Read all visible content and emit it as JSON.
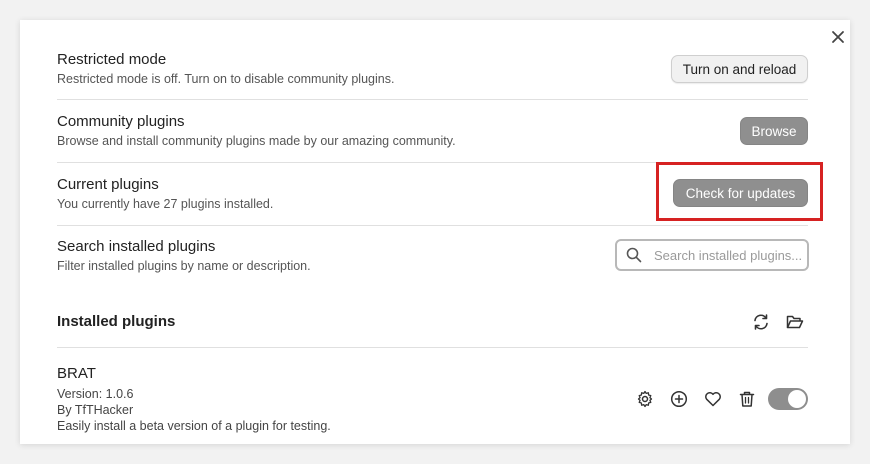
{
  "settings": {
    "restricted_mode": {
      "title": "Restricted mode",
      "description": "Restricted mode is off. Turn on to disable community plugins.",
      "button": "Turn on and reload"
    },
    "community_plugins": {
      "title": "Community plugins",
      "description": "Browse and install community plugins made by our amazing community.",
      "button": "Browse"
    },
    "current_plugins": {
      "title": "Current plugins",
      "description": "You currently have 27 plugins installed.",
      "button": "Check for updates"
    },
    "search_plugins": {
      "title": "Search installed plugins",
      "description": "Filter installed plugins by name or description.",
      "placeholder": "Search installed plugins..."
    }
  },
  "installed": {
    "heading": "Installed plugins",
    "plugins": [
      {
        "name": "BRAT",
        "version": "Version: 1.0.6",
        "author": "By TfTHacker",
        "description": "Easily install a beta version of a plugin for testing.",
        "enabled": true
      }
    ]
  },
  "icons": {
    "close": "close-icon",
    "search": "search-icon",
    "reload": "reload-icon",
    "folder": "folder-open-icon",
    "settings": "gear-icon",
    "add": "plus-circle-icon",
    "favorite": "heart-icon",
    "delete": "trash-icon"
  },
  "colors": {
    "highlight": "#d62222",
    "button_gray": "#8f8f8f",
    "toggle_on": "#8e8e8e"
  }
}
